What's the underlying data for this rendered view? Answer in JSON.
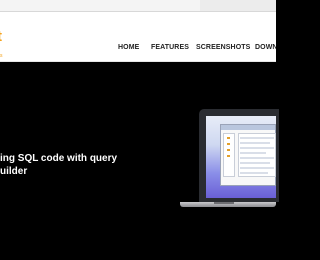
{
  "logo": {
    "letter": "t",
    "tagline": "s"
  },
  "nav": {
    "home": "HOME",
    "features": "FEATURES",
    "screenshots": "SCREENSHOTS",
    "download": "DOWN"
  },
  "hero": {
    "line1": "ing SQL code with query",
    "line2": "uilder"
  },
  "colors": {
    "brand": "#f5a21a",
    "nav_text": "#222222",
    "hero_bg": "#000000"
  }
}
